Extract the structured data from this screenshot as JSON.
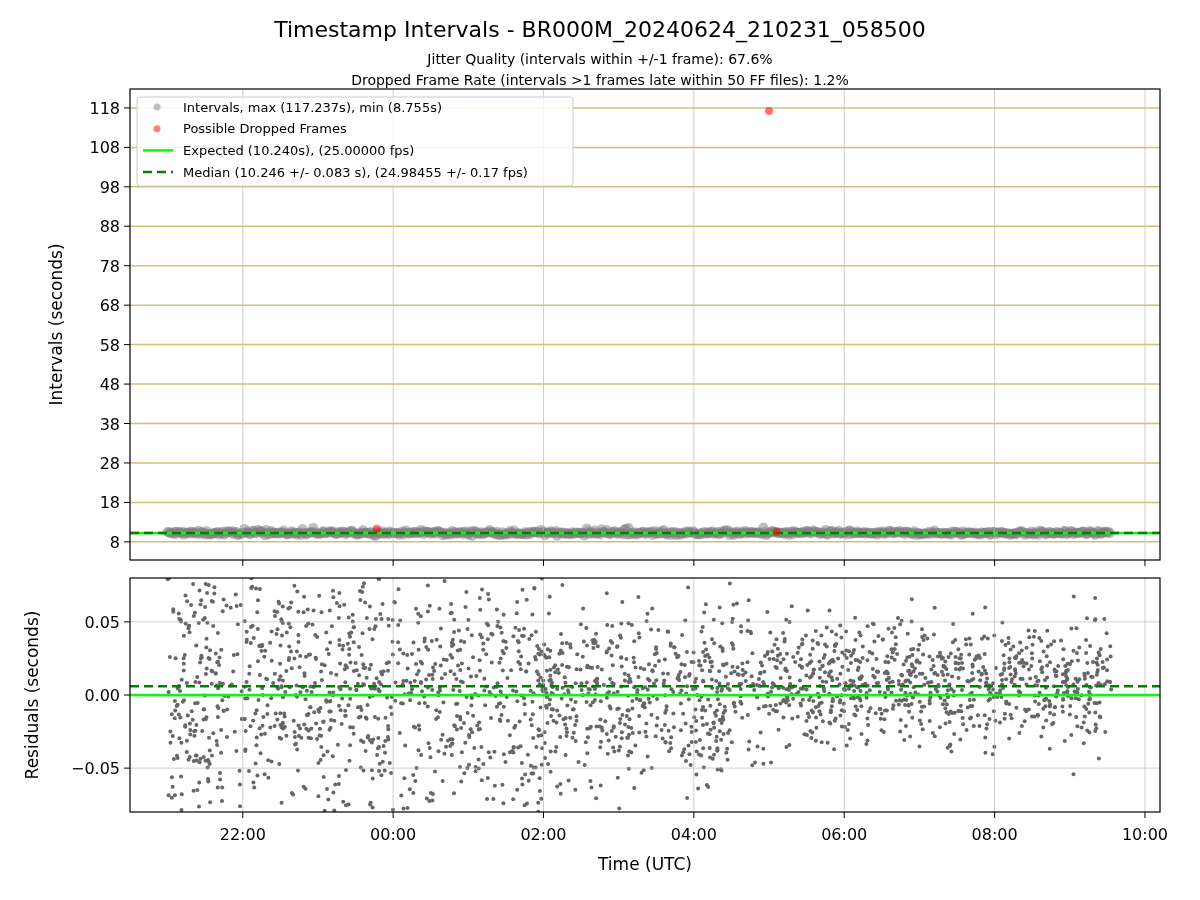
{
  "figure": {
    "title": "Timestamp Intervals - BR000M_20240624_210231_058500",
    "subtitles": [
      "Jitter Quality (intervals within +/-1 frame): 67.6%",
      "Dropped Frame Rate (intervals >1 frames late within 50 FF files): 1.2%"
    ]
  },
  "plots": [
    {
      "chart_data": {
        "type": "scatter",
        "ylabel": "Intervals (seconds)",
        "grid": true,
        "xlim": [
          "2024-06-24T20:30",
          "2024-06-25T10:12"
        ],
        "ylim": [
          3.4,
          122.8
        ],
        "yticks": [
          {
            "value": 8,
            "label": "8"
          },
          {
            "value": 18,
            "label": "18"
          },
          {
            "value": 28,
            "label": "28"
          },
          {
            "value": 38,
            "label": "38"
          },
          {
            "value": 48,
            "label": "48"
          },
          {
            "value": 58,
            "label": "58"
          },
          {
            "value": 68,
            "label": "68"
          },
          {
            "value": 78,
            "label": "78"
          },
          {
            "value": 88,
            "label": "88"
          },
          {
            "value": 98,
            "label": "98"
          },
          {
            "value": 108,
            "label": "108"
          },
          {
            "value": 118,
            "label": "118"
          }
        ],
        "x": [
          "2024-06-24T23:47",
          "2024-06-25T05:00",
          "2024-06-25T05:06"
        ],
        "series": [
          {
            "name": "Intervals, max (117.237s), min (8.755s)",
            "color": "#808080",
            "values": [
              null,
              null,
              null
            ]
          },
          {
            "name": "Possible Dropped Frames",
            "color": "#ff0000",
            "values": [
              11.3,
              117.2,
              10.5
            ]
          }
        ],
        "legend": "upper left",
        "ref_lines": [
          {
            "axis": "y",
            "value": 10.24,
            "label": "Expected (10.240s), (25.00000 fps)",
            "color": "#00ff00"
          },
          {
            "axis": "y",
            "value": 10.246,
            "label": "Median (10.246 +/- 0.083 s), (24.98455 +/- 0.17 fps)",
            "color": "#008000"
          }
        ]
      }
    },
    {
      "chart_data": {
        "type": "scatter",
        "xlabel": "Time (UTC)",
        "ylabel": "Residuals (seconds)",
        "grid": true,
        "xlim": [
          "2024-06-24T20:30",
          "2024-06-25T10:12"
        ],
        "ylim": [
          -0.08,
          0.08
        ],
        "xticks": [
          {
            "value": "2024-06-24T22:00",
            "label": "22:00"
          },
          {
            "value": "2024-06-25T00:00",
            "label": "00:00"
          },
          {
            "value": "2024-06-25T02:00",
            "label": "02:00"
          },
          {
            "value": "2024-06-25T04:00",
            "label": "04:00"
          },
          {
            "value": "2024-06-25T06:00",
            "label": "06:00"
          },
          {
            "value": "2024-06-25T08:00",
            "label": "08:00"
          },
          {
            "value": "2024-06-25T10:00",
            "label": "10:00"
          }
        ],
        "yticks": [
          {
            "value": 0.05,
            "label": "0.05"
          },
          {
            "value": 0,
            "label": "0.00"
          },
          {
            "value": -0.05,
            "label": "−0.05"
          }
        ],
        "ref_lines": [
          {
            "axis": "y",
            "value": 0,
            "color": "#00ff00"
          },
          {
            "axis": "y",
            "value": 0.006,
            "color": "#008000"
          }
        ]
      }
    }
  ]
}
